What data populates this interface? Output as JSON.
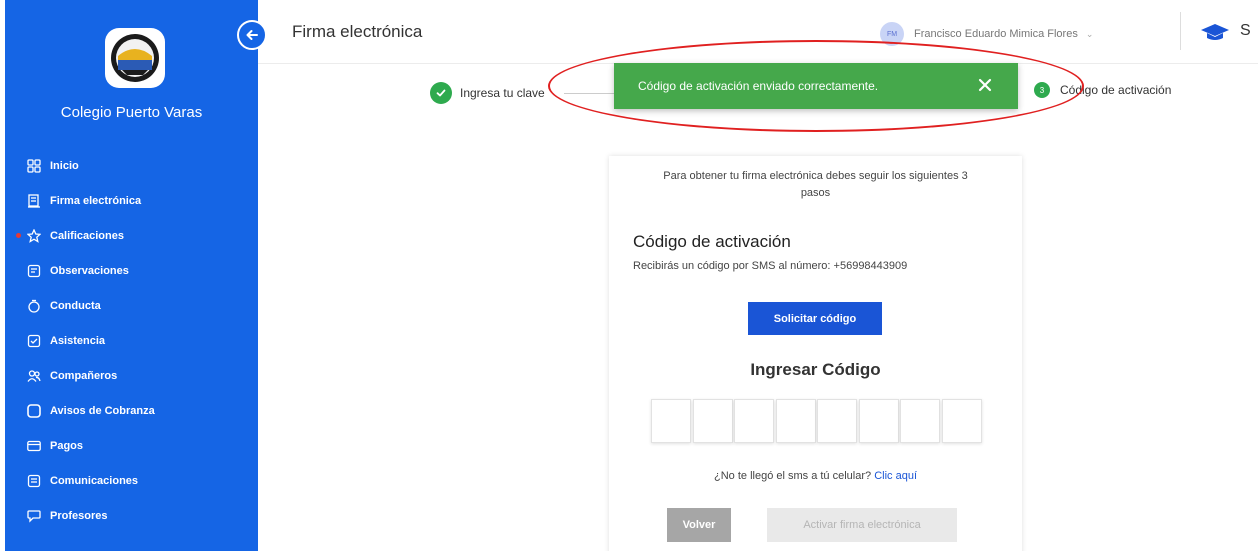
{
  "sidebar": {
    "school_name": "Colegio Puerto Varas",
    "logo_icon": "school-crest-icon",
    "accent_color": "#1565e5",
    "items": [
      {
        "label": "Inicio",
        "icon": "grid-icon"
      },
      {
        "label": "Firma electrónica",
        "icon": "document-sign-icon"
      },
      {
        "label": "Calificaciones",
        "icon": "star-icon",
        "notification_dot": true
      },
      {
        "label": "Observaciones",
        "icon": "note-icon"
      },
      {
        "label": "Conducta",
        "icon": "stopwatch-icon"
      },
      {
        "label": "Asistencia",
        "icon": "checkbox-icon"
      },
      {
        "label": "Compañeros",
        "icon": "people-icon"
      },
      {
        "label": "Avisos de Cobranza",
        "icon": "square-icon"
      },
      {
        "label": "Pagos",
        "icon": "card-icon"
      },
      {
        "label": "Comunicaciones",
        "icon": "message-icon"
      },
      {
        "label": "Profesores",
        "icon": "chat-bubble-icon"
      }
    ]
  },
  "header": {
    "title": "Firma electrónica",
    "user_initials": "FM",
    "user_name": "Francisco Eduardo Mimica Flores",
    "cut_label": "S"
  },
  "stepper": {
    "step1_label": "Ingresa tu clave",
    "step3_number": "3",
    "step3_label": "Código de activación"
  },
  "toast": {
    "message": "Código de activación enviado correctamente.",
    "color": "#45a84b"
  },
  "card": {
    "intro": "Para obtener tu firma electrónica debes seguir los siguientes 3 pasos",
    "title": "Código de activación",
    "sms_note": "Recibirás un código por SMS al número: +56998443909",
    "solicitar_label": "Solicitar código",
    "ingresar_title": "Ingresar Código",
    "resend_text": "¿No te llegó el sms a tú celular?",
    "resend_link": "Clic aquí",
    "volver_label": "Volver",
    "activar_label": "Activar firma electrónica"
  }
}
